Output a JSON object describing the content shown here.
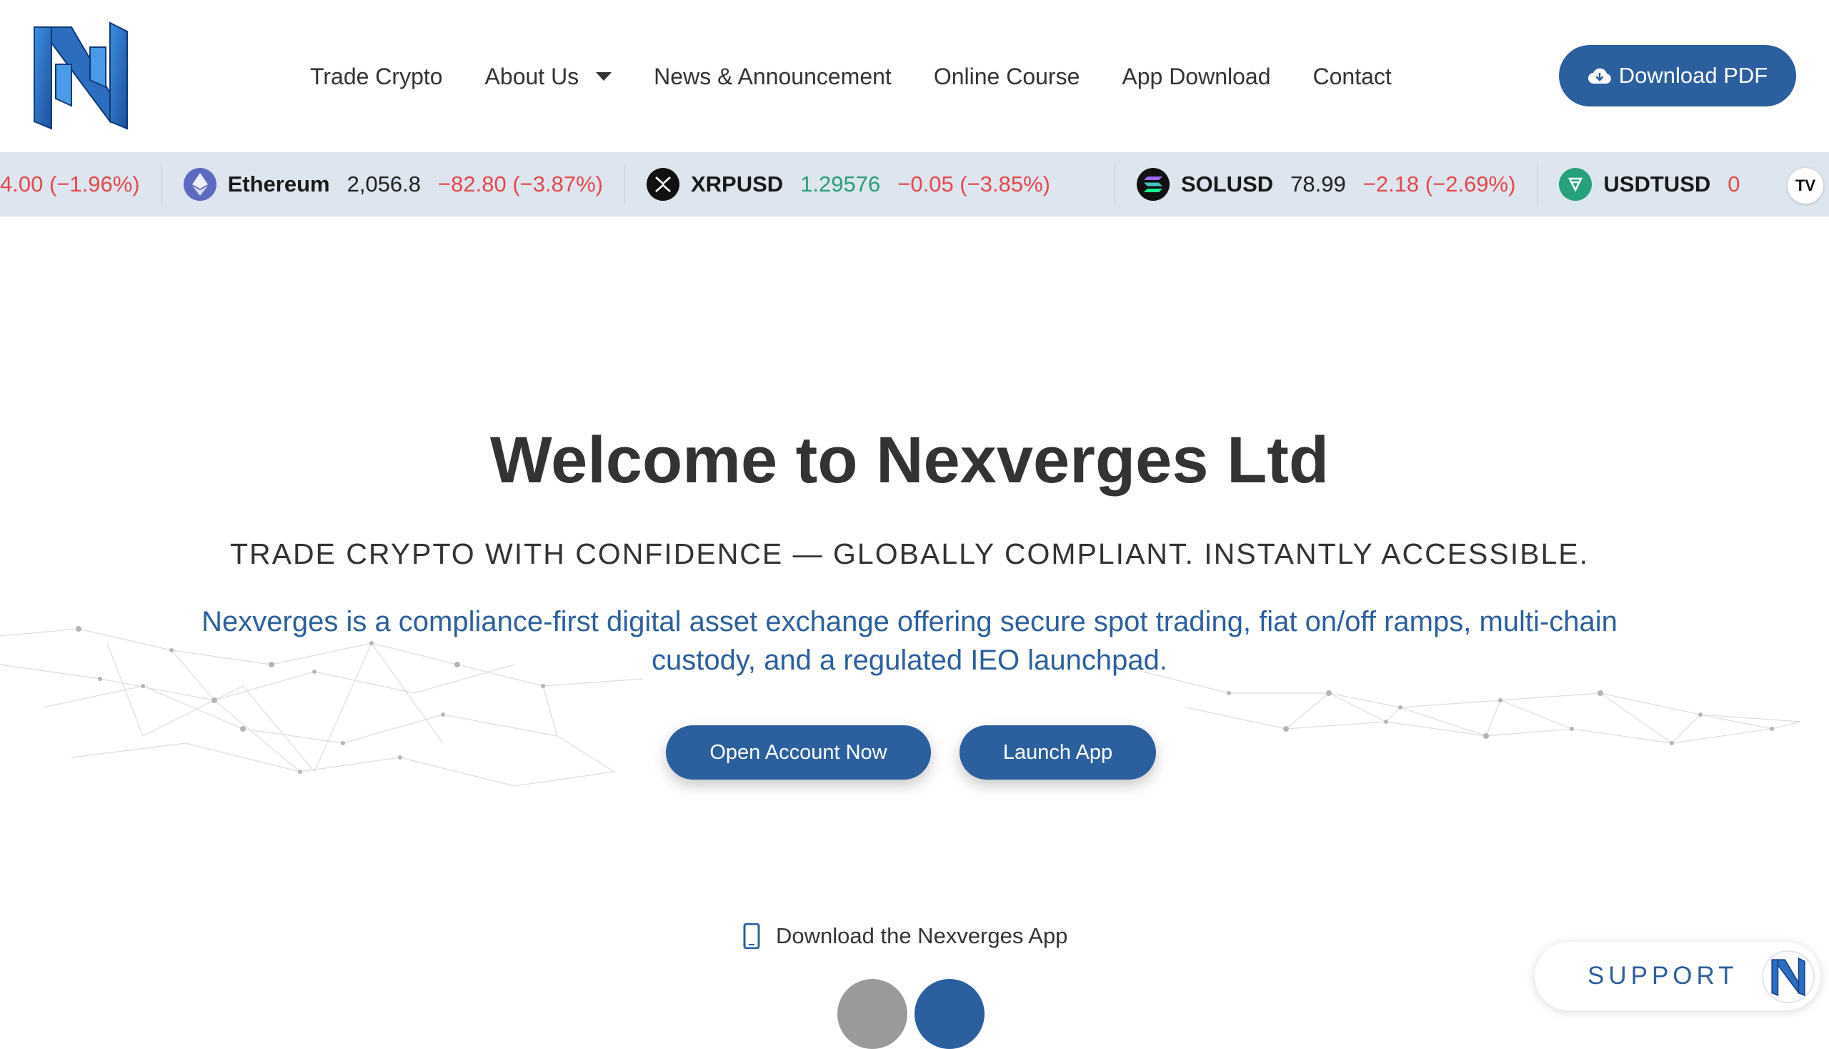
{
  "header": {
    "nav": [
      {
        "label": "Trade Crypto"
      },
      {
        "label": "About Us",
        "has_dropdown": true
      },
      {
        "label": "News & Announcement"
      },
      {
        "label": "Online Course"
      },
      {
        "label": "App Download"
      },
      {
        "label": "Contact"
      }
    ],
    "download_pdf": "Download PDF"
  },
  "ticker": {
    "items": [
      {
        "symbol": "",
        "price": "",
        "change": "4.00 (−1.96%)"
      },
      {
        "symbol": "Ethereum",
        "price": "2,056.8",
        "change": "−82.80 (−3.87%)",
        "icon": "ethereum-icon"
      },
      {
        "symbol": "XRPUSD",
        "price": "1.29576",
        "change": "−0.05 (−3.85%)",
        "icon": "xrp-icon"
      },
      {
        "symbol": "SOLUSD",
        "price": "78.99",
        "change": "−2.18 (−2.69%)",
        "icon": "solana-icon"
      },
      {
        "symbol": "USDTUSD",
        "price": "0",
        "change": "",
        "icon": "tether-icon"
      }
    ],
    "badge": "TV"
  },
  "hero": {
    "title": "Welcome to Nexverges Ltd",
    "subtitle": "TRADE CRYPTO WITH CONFIDENCE — GLOBALLY COMPLIANT. INSTANTLY ACCESSIBLE.",
    "description": "Nexverges is a compliance-first digital asset exchange offering secure spot trading, fiat on/off ramps, multi-chain custody, and a regulated IEO launchpad.",
    "open_account": "Open Account Now",
    "launch_app": "Launch App"
  },
  "app_download": {
    "label": "Download the Nexverges App"
  },
  "support": {
    "label": "SUPPORT"
  },
  "colors": {
    "brand": "#2b5f9e",
    "ticker_bg": "#dde5ee",
    "negative": "#e5484d",
    "positive": "#2a9d79"
  }
}
